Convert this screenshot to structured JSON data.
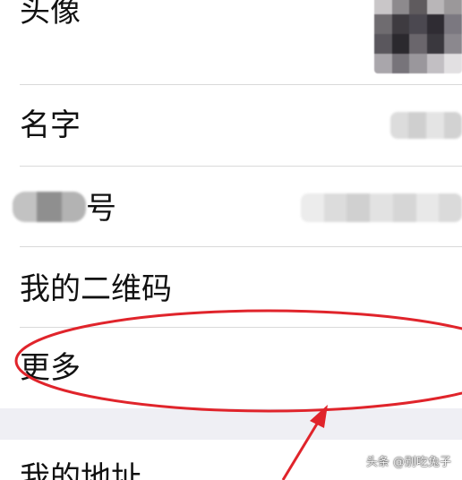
{
  "rows": {
    "avatar": {
      "label": "头像"
    },
    "name": {
      "label": "名字"
    },
    "account_id": {
      "label": "号"
    },
    "qr_code": {
      "label": "我的二维码"
    },
    "more": {
      "label": "更多"
    },
    "address": {
      "label": "我的地址"
    }
  },
  "annotation": {
    "color": "#e0242b"
  },
  "watermark": {
    "text": "头条 @别吃兔子"
  },
  "colors": {
    "background": "#ffffff",
    "section_gap": "#efeff4",
    "divider": "#d9d9d9",
    "text": "#111111"
  }
}
